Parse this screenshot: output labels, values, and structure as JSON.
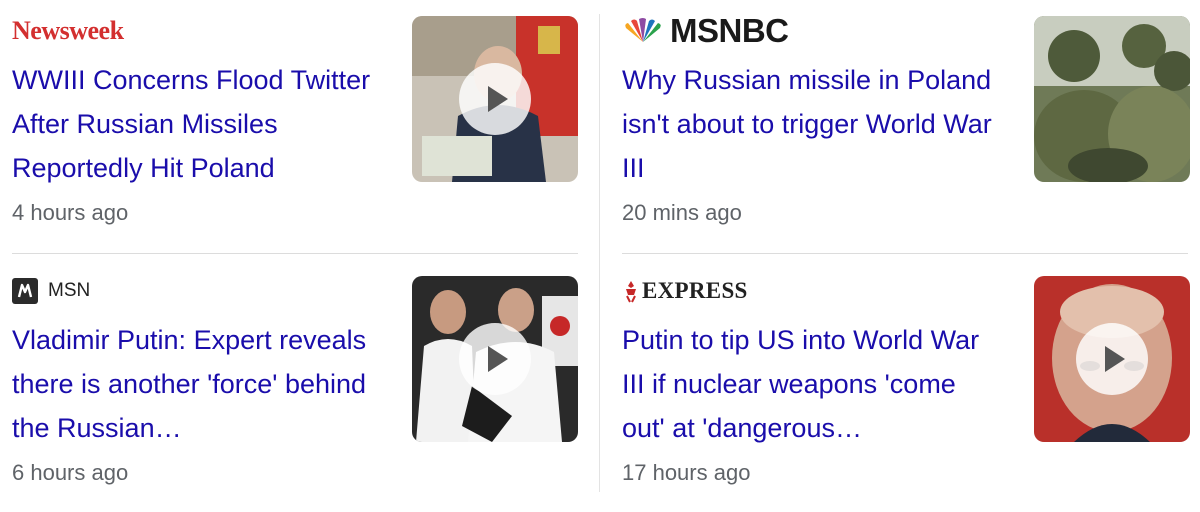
{
  "articles": [
    {
      "source": "Newsweek",
      "headline": "WWIII Concerns Flood Twitter After Russian Missiles Reportedly Hit Poland",
      "time": "4 hours ago",
      "thumb_icon": "play-icon"
    },
    {
      "source": "MSNBC",
      "headline": "Why Russian missile in Poland isn't about to trigger World War III",
      "time": "20 mins ago",
      "thumb_icon": "play-icon"
    },
    {
      "source": "MSN",
      "headline": "Vladimir Putin: Expert reveals there is another 'force' behind the Russian…",
      "time": "6 hours ago",
      "thumb_icon": "play-icon"
    },
    {
      "source": "EXPRESS",
      "headline": "Putin to tip US into World War III if nuclear weapons 'come out' at 'dangerous…",
      "time": "17 hours ago",
      "thumb_icon": "play-icon"
    }
  ],
  "colors": {
    "headline": "#1a0dab",
    "time": "#5f6368",
    "newsweek_red": "#d32f2f"
  }
}
